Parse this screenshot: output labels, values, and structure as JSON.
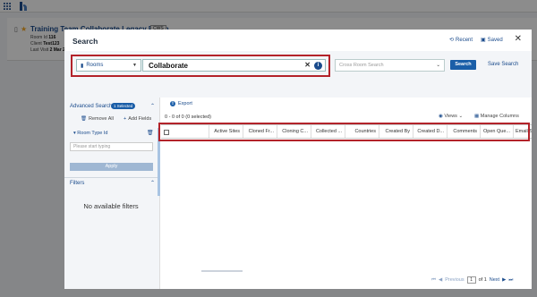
{
  "background": {
    "room": {
      "title": "Training Team Collaborate Legacy Room",
      "badge": "CWS",
      "room_id_label": "Room Id",
      "room_id_value": "116",
      "client_label": "Client",
      "client_value": "Test123",
      "last_visit_label": "Last Visit",
      "last_visit_value": "2 Mar 2026"
    }
  },
  "modal": {
    "title": "Search",
    "recent_label": "Recent",
    "saved_label": "Saved",
    "close_glyph": "✕",
    "search": {
      "scope_value": "Rooms",
      "query_value": "Collaborate",
      "cross_room_placeholder": "Cross Room Search",
      "search_button": "Search",
      "save_search": "Save Search"
    },
    "advanced": {
      "title": "Advanced Search",
      "selected_badge": "1 Selected",
      "remove_all": "Remove All",
      "add_fields": "Add Fields",
      "field_label": "Room Type Id",
      "field_placeholder": "Please start typing",
      "apply": "Apply"
    },
    "filters": {
      "title": "Filters",
      "empty_text": "No available filters"
    },
    "results": {
      "export": "Export",
      "selection_count": "0 - 0 of 0 (0 selected)",
      "views": "Views",
      "manage_columns": "Manage Columns",
      "columns": [
        "Active Sites",
        "Cloned Fr...",
        "Cloning C...",
        "Collected ...",
        "Countries",
        "Created By",
        "Created D...",
        "Comments",
        "Open Que...",
        "Email Sen"
      ]
    },
    "pagination": {
      "previous": "Previous",
      "page": "1",
      "of_text": "of 1",
      "next": "Next"
    }
  },
  "colors": {
    "accent": "#1a4b8c",
    "highlight": "#b3232a",
    "primary_button": "#1a5ea8"
  }
}
